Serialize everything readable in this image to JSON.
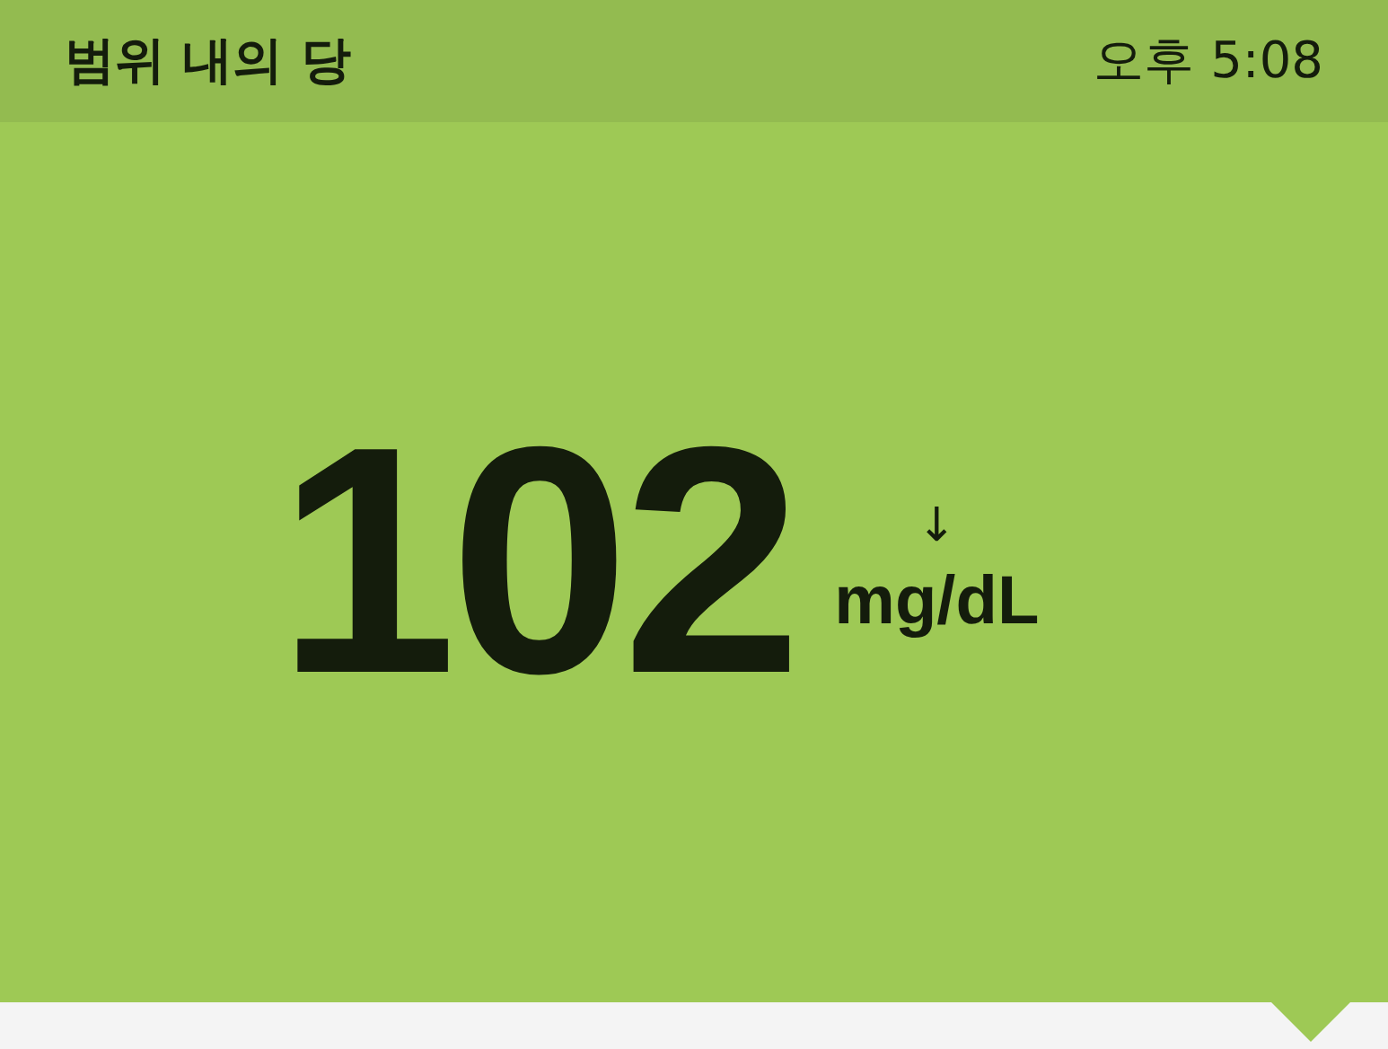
{
  "header": {
    "title": "범위 내의 당",
    "time": "오후 5:08"
  },
  "reading": {
    "value": "102",
    "unit": "mg/dL",
    "trend_arrow": "↓"
  }
}
